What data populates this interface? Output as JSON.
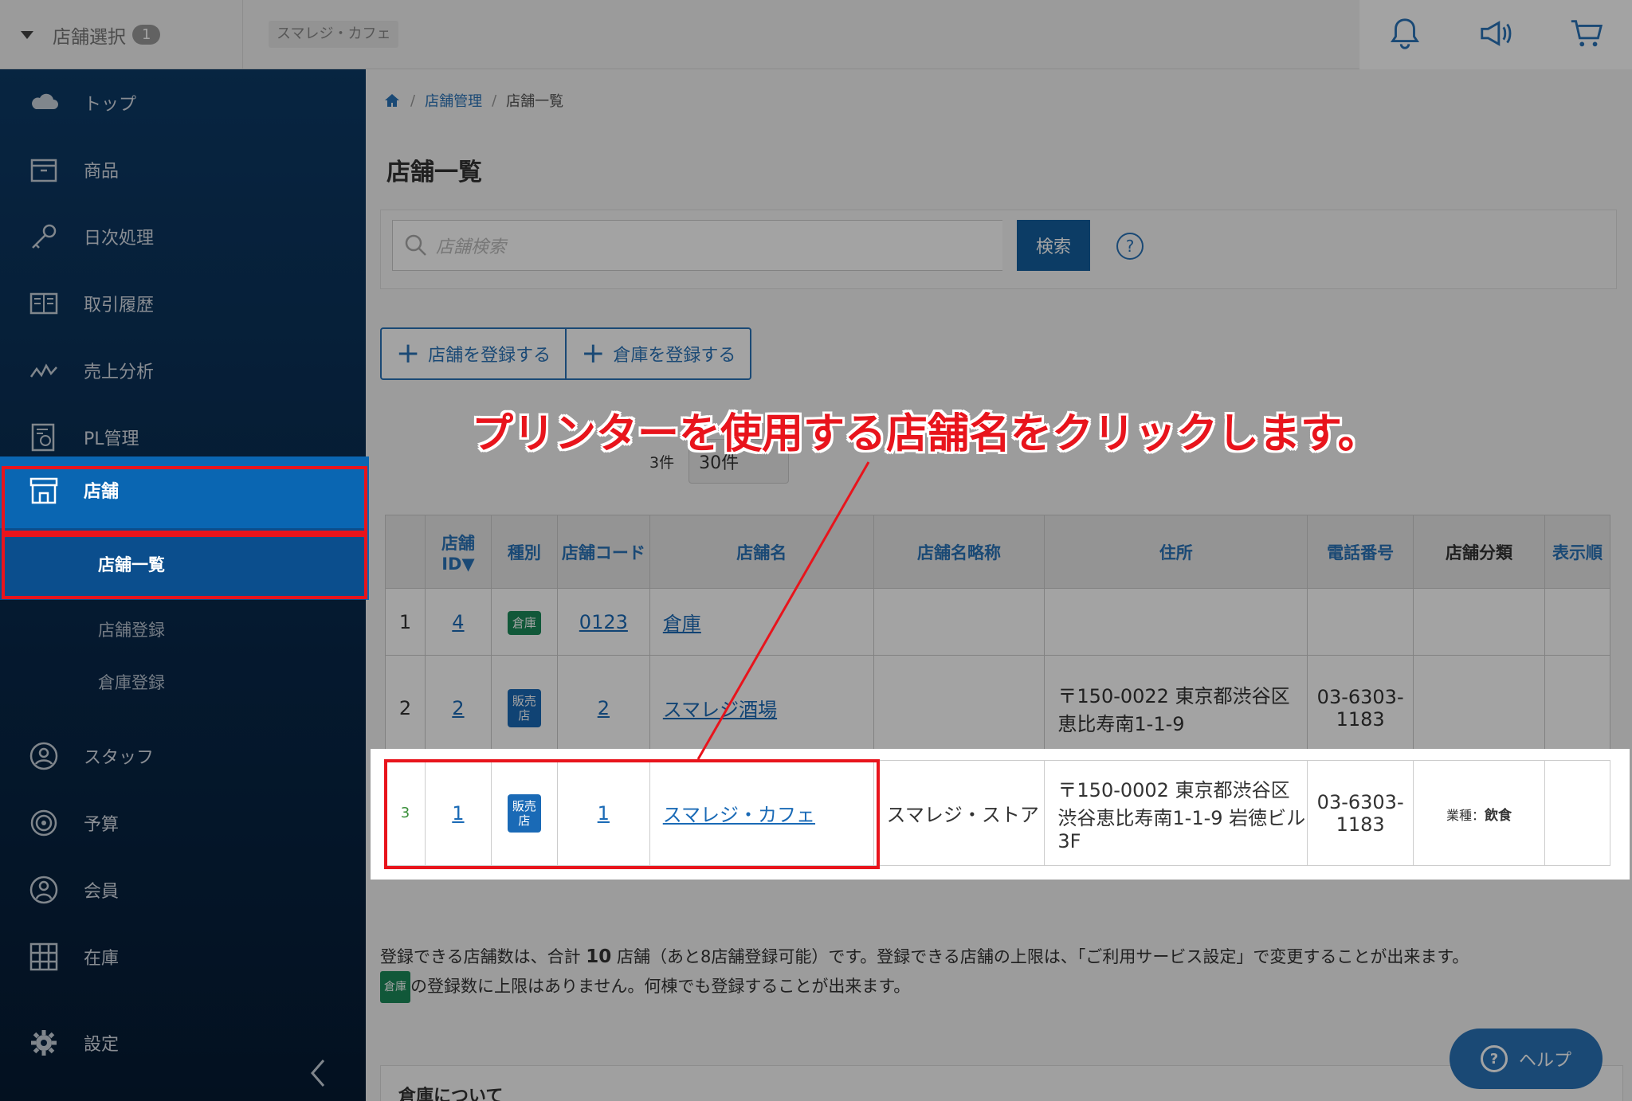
{
  "header": {
    "store_select_label": "店舗選択",
    "store_count": "1",
    "current_store": "スマレジ・カフェ",
    "icons": [
      "bell-icon",
      "megaphone-icon",
      "cart-icon"
    ]
  },
  "sidebar": {
    "items": [
      {
        "label": "トップ",
        "icon": "cloud-icon"
      },
      {
        "label": "商品",
        "icon": "box-icon"
      },
      {
        "label": "日次処理",
        "icon": "key-icon"
      },
      {
        "label": "取引履歴",
        "icon": "book-icon"
      },
      {
        "label": "売上分析",
        "icon": "chart-line-icon"
      },
      {
        "label": "PL管理",
        "icon": "report-icon"
      },
      {
        "label": "店舗",
        "icon": "store-icon"
      },
      {
        "label": "スタッフ",
        "icon": "user-circle-icon"
      },
      {
        "label": "予算",
        "icon": "target-icon"
      },
      {
        "label": "会員",
        "icon": "member-icon"
      },
      {
        "label": "在庫",
        "icon": "grid-icon"
      },
      {
        "label": "設定",
        "icon": "gear-icon"
      }
    ],
    "sub_items": [
      "店舗一覧",
      "店舗登録",
      "倉庫登録"
    ]
  },
  "breadcrumb": [
    "店舗管理",
    "店舗一覧"
  ],
  "page_title": "店舗一覧",
  "search": {
    "placeholder": "店舗検索",
    "button": "検索",
    "help": "?"
  },
  "register_buttons": [
    "店舗を登録する",
    "倉庫を登録する"
  ],
  "result_count": "3件",
  "per_page": "30件",
  "table": {
    "headers": [
      "",
      "店舗ID▼",
      "種別",
      "店舗コード",
      "店舗名",
      "店舗名略称",
      "住所",
      "電話番号",
      "店舗分類",
      "表示順"
    ],
    "rows": [
      {
        "num": "1",
        "id": "4",
        "type": "倉庫",
        "code": "0123",
        "name": "倉庫",
        "short": "",
        "address": "",
        "phone": "",
        "category_label": "",
        "category_value": "",
        "order": ""
      },
      {
        "num": "2",
        "id": "2",
        "type": "販売店",
        "code": "2",
        "name": "スマレジ酒場",
        "short": "",
        "address": "〒150-0022 東京都渋谷区恵比寿南1-1-9",
        "phone": "03-6303-1183",
        "category_label": "",
        "category_value": "",
        "order": ""
      },
      {
        "num": "3",
        "id": "1",
        "type": "販売店",
        "code": "1",
        "name": "スマレジ・カフェ",
        "short": "スマレジ・ストア",
        "address": "〒150-0002 東京都渋谷区渋谷恵比寿南1-1-9 岩徳ビル3F",
        "phone": "03-6303-1183",
        "category_label": "業種：",
        "category_value": "飲食",
        "order": ""
      }
    ]
  },
  "note": {
    "line1_a": "登録できる店舗数は、合計",
    "line1_num": "10",
    "line1_b": "店舗（あと8店舗登録可能）です。登録できる店舗の上限は、「ご利用サービス設定」で変更することが出来ます。",
    "line2_tag": "倉庫",
    "line2": "の登録数に上限はありません。何棟でも登録することが出来ます。"
  },
  "help_button": "ヘルプ",
  "bottom_panel_title": "倉庫について",
  "callout": "プリンターを使用する店舗名をクリックします。",
  "colors": {
    "accent": "#0a66b2",
    "highlight": "#e8141c",
    "warehouse_tag": "#1b8a5a"
  }
}
